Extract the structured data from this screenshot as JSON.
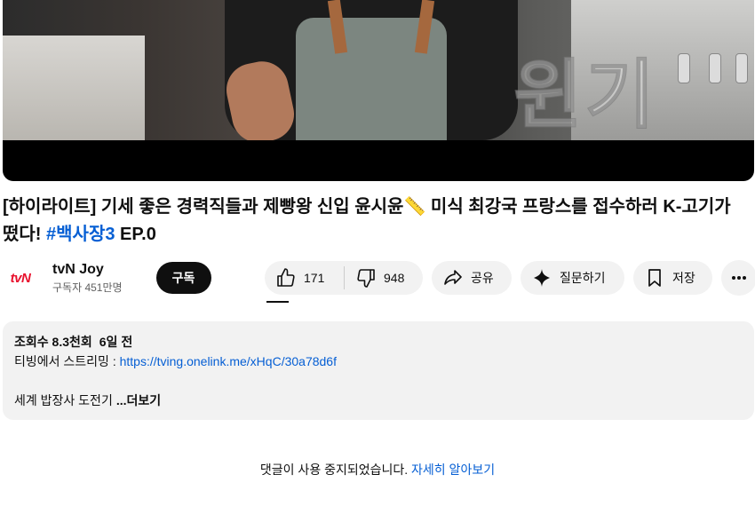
{
  "video": {
    "watermark_text": "윈기",
    "player_accent": "#000000"
  },
  "title": {
    "main": "[하이라이트] 기세 좋은 경력직들과 제빵왕 신입 윤시윤",
    "emoji": "📏",
    "rest": " 미식 최강국 프랑스를 접수하러 K-고기가 떴다! ",
    "hashtag": "#백사장3",
    "episode": " EP.0"
  },
  "channel": {
    "logo_text": "tvN",
    "logo_color": "#e8112d",
    "name": "tvN Joy",
    "subscribers": "구독자 451만명",
    "subscribe_label": "구독"
  },
  "actions": {
    "like_icon": "thumbs-up-icon",
    "like_count": "171",
    "dislike_icon": "thumbs-down-icon",
    "dislike_count": "948",
    "share_icon": "share-arrow-icon",
    "share_label": "공유",
    "ask_icon": "sparkle-icon",
    "ask_label": "질문하기",
    "save_icon": "bookmark-icon",
    "save_label": "저장",
    "more_icon": "more-horizontal-icon"
  },
  "description": {
    "views": "조회수 8.3천회",
    "age": "6일 전",
    "stream_prefix": "티빙에서 스트리밍 : ",
    "stream_link": "https://tving.onelink.me/xHqC/30a78d6f",
    "snippet": "세계 밥장사 도전기",
    "more_label": "...더보기"
  },
  "comments": {
    "disabled_text": "댓글이 사용 중지되었습니다. ",
    "learn_more": "자세히 알아보기"
  },
  "colors": {
    "link": "#065fd4",
    "pill_bg": "#f2f2f2",
    "text": "#0f0f0f",
    "secondary_text": "#606060"
  }
}
